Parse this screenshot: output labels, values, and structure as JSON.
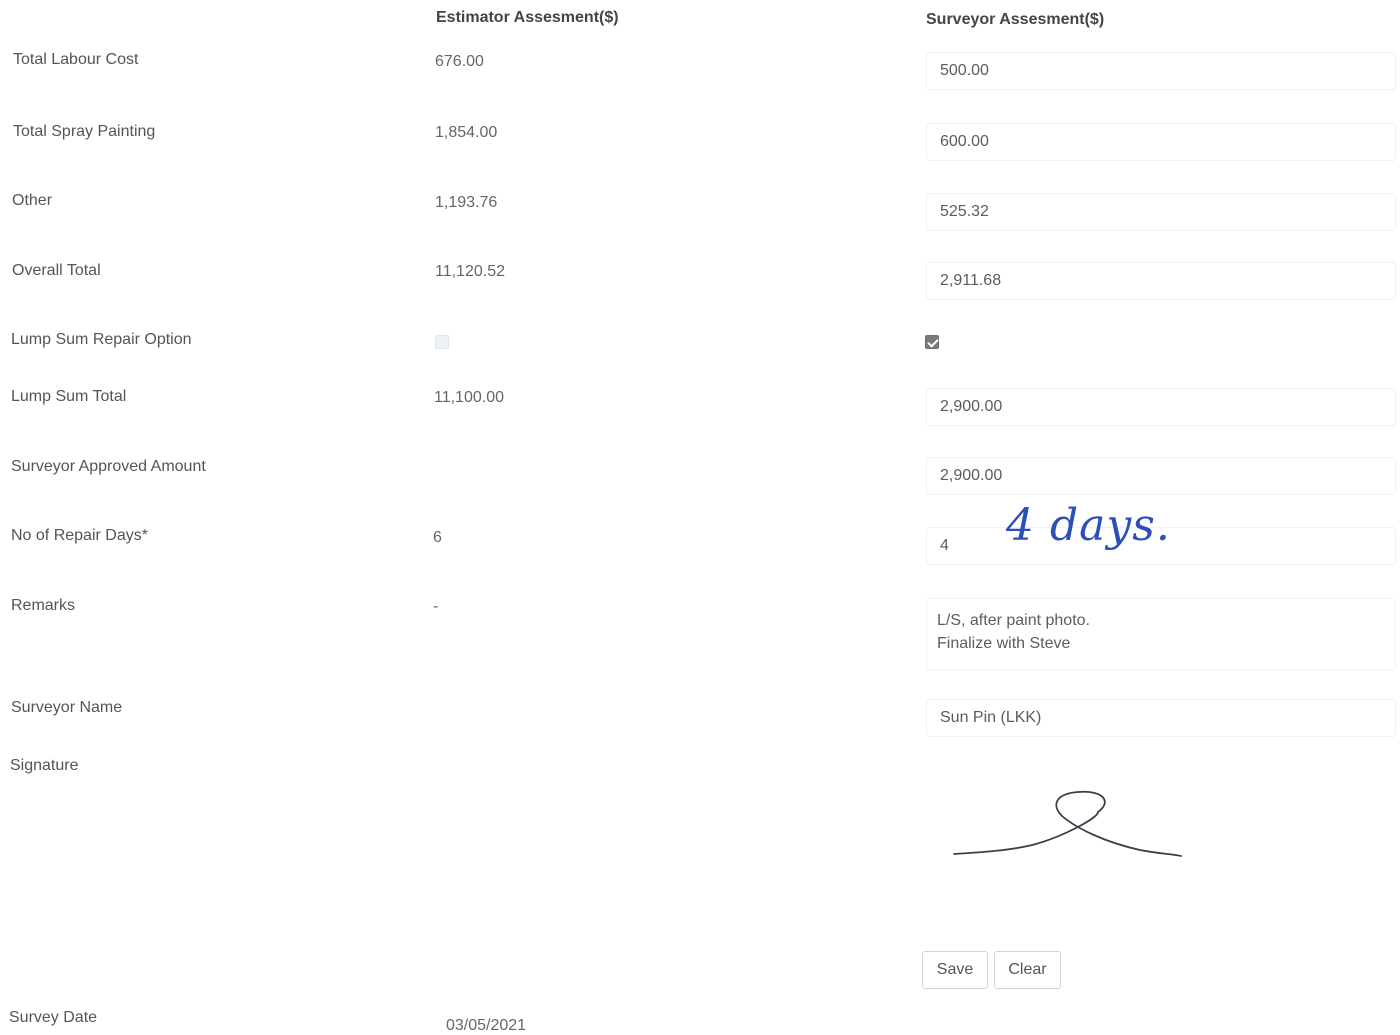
{
  "headers": {
    "estimator": "Estimator Assesment($)",
    "surveyor": "Surveyor Assesment($)"
  },
  "rows": {
    "total_labour_cost": {
      "label": "Total Labour Cost",
      "estimator": "676.00",
      "surveyor": "500.00"
    },
    "total_spray_painting": {
      "label": "Total Spray Painting",
      "estimator": "1,854.00",
      "surveyor": "600.00"
    },
    "other": {
      "label": "Other",
      "estimator": "1,193.76",
      "surveyor": "525.32"
    },
    "overall_total": {
      "label": "Overall Total",
      "estimator": "11,120.52",
      "surveyor": "2,911.68"
    },
    "lump_sum_repair_option": {
      "label": "Lump Sum Repair Option",
      "estimator_checked": true,
      "estimator_disabled": true,
      "surveyor_checked": true
    },
    "lump_sum_total": {
      "label": "Lump Sum Total",
      "estimator": "11,100.00",
      "surveyor": "2,900.00"
    },
    "surveyor_approved_amount": {
      "label": "Surveyor Approved Amount",
      "surveyor": "2,900.00"
    },
    "no_of_repair_days": {
      "label": "No of Repair Days*",
      "estimator": "6",
      "surveyor": "4",
      "handwritten_note": "4 days."
    },
    "remarks": {
      "label": "Remarks",
      "estimator": "-",
      "surveyor": "L/S, after paint photo.\nFinalize with Steve"
    },
    "surveyor_name": {
      "label": "Surveyor Name",
      "surveyor": "Sun Pin (LKK)"
    },
    "signature": {
      "label": "Signature"
    },
    "survey_date": {
      "label": "Survey Date",
      "value": "03/05/2021"
    }
  },
  "buttons": {
    "save": "Save",
    "clear": "Clear"
  },
  "colors": {
    "text": "#5a5a5a",
    "header": "#454545",
    "handwriting_ink": "#2d4fb8",
    "signature_ink": "#3a3f4a",
    "field_border": "#f1f1f1",
    "button_border": "#d4d4d4"
  }
}
